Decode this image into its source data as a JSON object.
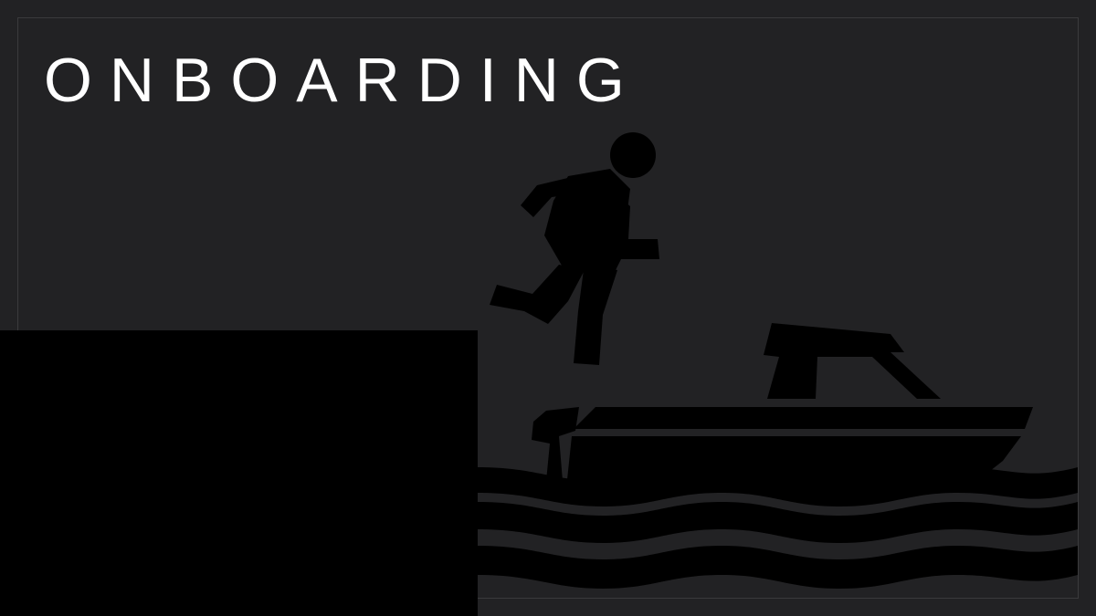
{
  "title": "ONBOARDING",
  "colors": {
    "background": "#222224",
    "silhouette": "#000000",
    "title": "#ffffff",
    "frame": "#3a3a3c"
  },
  "icons": [
    "person-running-icon",
    "boat-icon",
    "dock-icon",
    "waves-icon"
  ]
}
